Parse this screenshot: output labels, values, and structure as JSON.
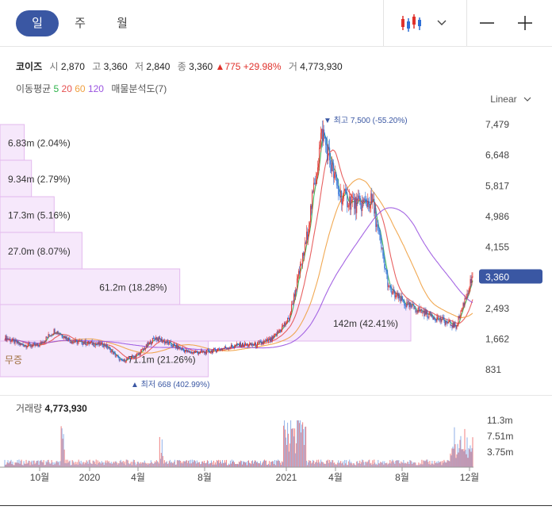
{
  "tabs": [
    {
      "label": "일"
    },
    {
      "label": "주"
    },
    {
      "label": "월"
    }
  ],
  "toolbar": {
    "candle_icon": "candlestick-icon",
    "dropdown_icon": "chevron-down-icon",
    "zoom_out_icon": "minus-icon",
    "zoom_in_icon": "plus-icon"
  },
  "info": {
    "name": "코이즈",
    "open_label": "시",
    "open": "2,870",
    "high_label": "고",
    "high": "3,360",
    "low_label": "저",
    "low": "2,840",
    "close_label": "종",
    "close": "3,360",
    "change": "▲775",
    "change_pct": "+29.98%",
    "vol_label": "거",
    "volume": "4,773,930"
  },
  "ma": {
    "label": "이동평균",
    "p5": "5",
    "p20": "20",
    "p60": "60",
    "p120": "120",
    "vp": "매물분석도(7)"
  },
  "scale_label": "Linear",
  "colors": {
    "up": "#e0312b",
    "down": "#2f6fd6",
    "accent": "#3a57a3",
    "ma5": "#2db34a",
    "ma20": "#e65050",
    "ma60": "#f0a040",
    "ma120": "#9b55e0",
    "vp": "#f6e8fb"
  },
  "chart_data": {
    "type": "candlestick",
    "y_axis_ticks": [
      "7,479",
      "6,648",
      "5,817",
      "4,986",
      "4,155",
      "2,493",
      "1,662",
      "831"
    ],
    "current_price": "3,360",
    "max_annotation": "▼ 최고 7,500 (-55.20%)",
    "min_annotation": "▲ 최저 668 (402.99%)",
    "x_axis_ticks": [
      "10월",
      "2020",
      "4월",
      "8월",
      "2021",
      "4월",
      "8월",
      "12월"
    ],
    "volume_profile": [
      {
        "label": "6.83m (2.04%)",
        "share": 2.04
      },
      {
        "label": "9.34m (2.79%)",
        "share": 2.79
      },
      {
        "label": "17.3m (5.16%)",
        "share": 5.16
      },
      {
        "label": "27.0m (8.07%)",
        "share": 8.07
      },
      {
        "label": "61.2m (18.28%)",
        "share": 18.28
      },
      {
        "label": "142m (42.41%)",
        "share": 42.41
      },
      {
        "label": "71.1m (21.26%)",
        "share": 21.26
      }
    ],
    "profile_extra_label": "무증",
    "price_series": [
      {
        "x": "2019-08",
        "close": 1700
      },
      {
        "x": "2019-09",
        "close": 1500
      },
      {
        "x": "2019-10",
        "close": 1480
      },
      {
        "x": "2019-11",
        "close": 1900
      },
      {
        "x": "2019-12",
        "close": 1600
      },
      {
        "x": "2020-01",
        "close": 1550
      },
      {
        "x": "2020-02",
        "close": 1500
      },
      {
        "x": "2020-03",
        "close": 1050
      },
      {
        "x": "2020-04",
        "close": 1250
      },
      {
        "x": "2020-05",
        "close": 1700
      },
      {
        "x": "2020-06",
        "close": 1500
      },
      {
        "x": "2020-07",
        "close": 1300
      },
      {
        "x": "2020-08",
        "close": 1300
      },
      {
        "x": "2020-09",
        "close": 1400
      },
      {
        "x": "2020-10",
        "close": 1500
      },
      {
        "x": "2020-11",
        "close": 1500
      },
      {
        "x": "2020-12",
        "close": 1650
      },
      {
        "x": "2021-01",
        "close": 2200
      },
      {
        "x": "2021-02",
        "close": 4200
      },
      {
        "x": "2021-03",
        "close": 7300
      },
      {
        "x": "2021-04",
        "close": 5600
      },
      {
        "x": "2021-05",
        "close": 5300
      },
      {
        "x": "2021-06",
        "close": 5400
      },
      {
        "x": "2021-07",
        "close": 3000
      },
      {
        "x": "2021-08",
        "close": 2600
      },
      {
        "x": "2021-09",
        "close": 2400
      },
      {
        "x": "2021-10",
        "close": 2200
      },
      {
        "x": "2021-11",
        "close": 2000
      },
      {
        "x": "2021-12",
        "close": 3360
      }
    ],
    "volume_axis_ticks": [
      "11.3m",
      "7.51m",
      "3.75m"
    ],
    "volume_header_label": "거래량",
    "volume_header_value": "4,773,930"
  }
}
